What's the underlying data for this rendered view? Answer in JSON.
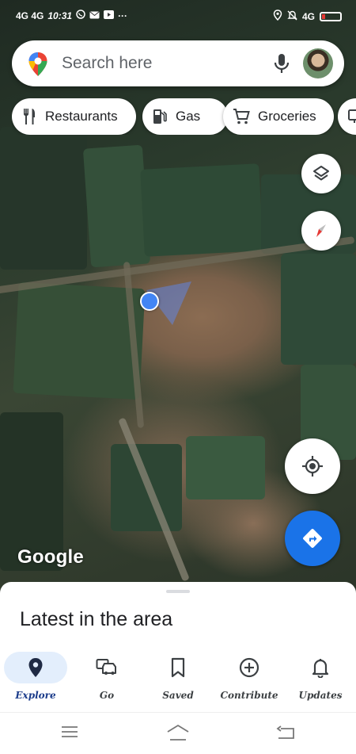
{
  "status_bar": {
    "network_left": "4G 4G",
    "time": "10:31",
    "more": "···",
    "network_right": "4G",
    "battery_level": 0.18
  },
  "search": {
    "placeholder": "Search here"
  },
  "chips": [
    {
      "label": "Restaurants",
      "icon": "fork-knife-icon"
    },
    {
      "label": "Gas",
      "icon": "gas-pump-icon"
    },
    {
      "label": "Groceries",
      "icon": "cart-icon"
    },
    {
      "label": "",
      "icon": "more-category-icon"
    }
  ],
  "map": {
    "attribution": "Google",
    "location_color": "#4285f4"
  },
  "sheet": {
    "title": "Latest in the area"
  },
  "nav": [
    {
      "label": "Explore",
      "icon": "pin-icon",
      "active": true
    },
    {
      "label": "Go",
      "icon": "car-icon",
      "active": false
    },
    {
      "label": "Saved",
      "icon": "bookmark-icon",
      "active": false
    },
    {
      "label": "Contribute",
      "icon": "add-circle-icon",
      "active": false
    },
    {
      "label": "Updates",
      "icon": "bell-icon",
      "active": false
    }
  ],
  "colors": {
    "accent": "#1a73e8",
    "explore_active_bg": "#e3eefc"
  }
}
